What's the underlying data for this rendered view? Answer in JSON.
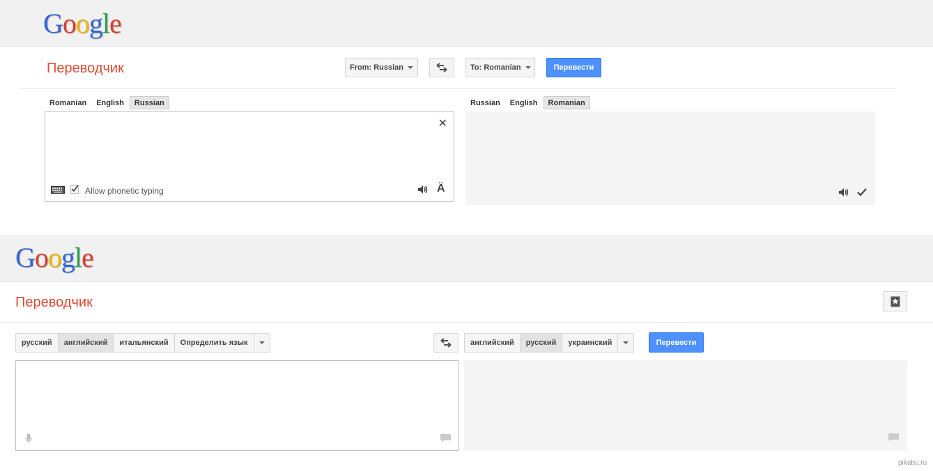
{
  "old_ui": {
    "logo": [
      "G",
      "o",
      "o",
      "g",
      "l",
      "e"
    ],
    "title": "Переводчик",
    "from_button": "From: Russian",
    "to_button": "To: Romanian",
    "translate_button": "Перевести",
    "source_tabs": [
      "Romanian",
      "English",
      "Russian"
    ],
    "source_active": "Russian",
    "target_tabs": [
      "Russian",
      "English",
      "Romanian"
    ],
    "target_active": "Romanian",
    "phonetic_label": "Allow phonetic typing",
    "phonetic_checked": true,
    "accent_char": "Ä"
  },
  "new_ui": {
    "logo": [
      "G",
      "o",
      "o",
      "g",
      "l",
      "e"
    ],
    "title": "Переводчик",
    "source_langs": [
      "русский",
      "английский",
      "итальянский",
      "Определить язык"
    ],
    "source_active": "английский",
    "target_langs": [
      "английский",
      "русский",
      "украинский"
    ],
    "target_active": "русский",
    "translate_button": "Перевести"
  },
  "watermark": "pikabu.ru",
  "icons": {
    "swap": "swap-arrows-icon",
    "clear": "close-icon",
    "keyboard": "keyboard-icon",
    "speaker": "speaker-icon",
    "check": "checkmark-icon",
    "mic": "microphone-icon",
    "feedback": "speech-bubble-icon",
    "star": "star-bookmark-icon"
  },
  "colors": {
    "title_red": "#dd4b39",
    "button_blue": "#4d90fe",
    "header_gray": "#f1f1f1",
    "output_gray": "#f5f5f5"
  }
}
